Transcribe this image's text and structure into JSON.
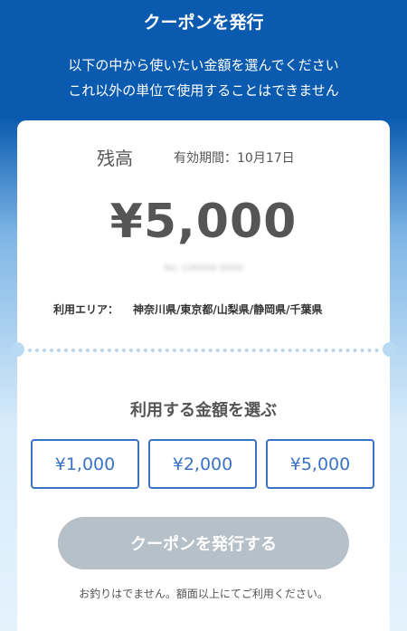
{
  "header": {
    "title": "クーポンを発行",
    "subtitle_line1": "以下の中から使いたい金額を選んでください",
    "subtitle_line2": "これ以外の単位で使用することはできません"
  },
  "coupon": {
    "balance_label": "残高",
    "expiry": "有効期間：10月17日",
    "amount": "¥5,000",
    "number": "No. C00000 0000",
    "area_label": "利用エリア：",
    "area_value": "神奈川県/東京都/山梨県/静岡県/千葉県"
  },
  "selection": {
    "title": "利用する金額を選ぶ",
    "options": [
      "¥1,000",
      "¥2,000",
      "¥5,000"
    ]
  },
  "issue_button": "クーポンを発行する",
  "note": "お釣りはでません。額面以上にてご利用ください。",
  "colors": {
    "header_blue": "#0a5bb0",
    "accent_blue": "#3a72c6",
    "disabled_gray": "#b6c0c8"
  }
}
